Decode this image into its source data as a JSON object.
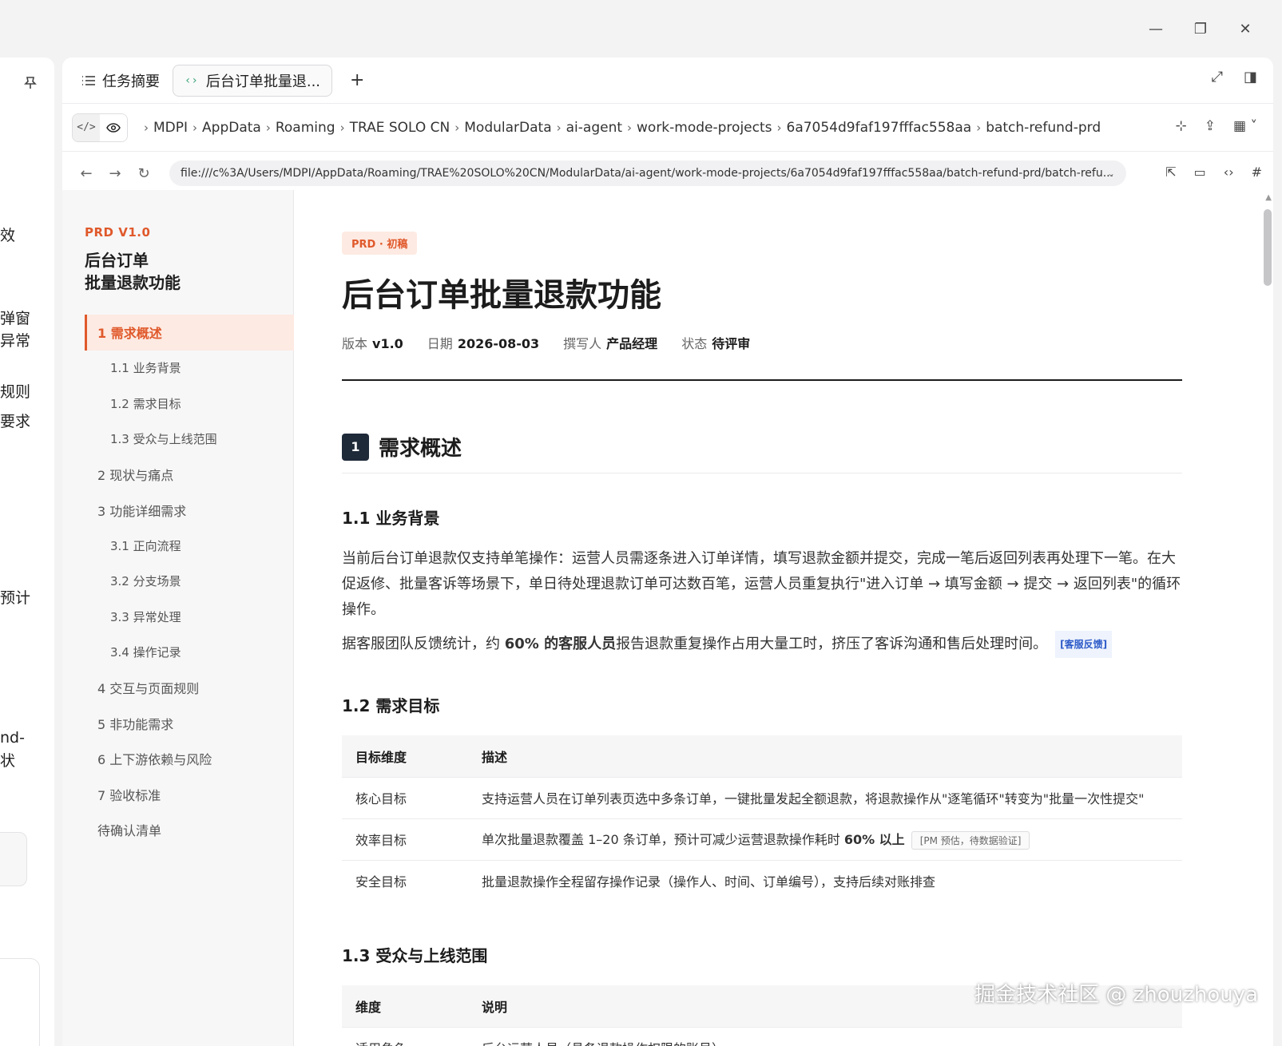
{
  "window": {
    "minimize": "—",
    "restore": "❐",
    "close": "✕"
  },
  "left_strip": {
    "texts": [
      "效",
      "弹窗",
      "异常",
      "规则",
      "要求",
      "预计",
      "nd-",
      "状"
    ]
  },
  "tabs": {
    "summary_label": "任务摘要",
    "active_label": "后台订单批量退...",
    "add_label": "+"
  },
  "breadcrumbs": [
    "MDPI",
    "AppData",
    "Roaming",
    "TRAE SOLO CN",
    "ModularData",
    "ai-agent",
    "work-mode-projects",
    "6a7054d9faf197fffac558aa",
    "batch-refund-prd",
    "batch-refund-prd."
  ],
  "url": {
    "value": "file:///c%3A/Users/MDPI/AppData/Roaming/TRAE%20SOLO%20CN/ModularData/ai-agent/work-mode-projects/6a7054d9faf197fffac558aa/batch-refund-prd/batch-refu..."
  },
  "toc": {
    "tag": "PRD V1.0",
    "title_line1": "后台订单",
    "title_line2": "批量退款功能",
    "items": [
      {
        "label": "1 需求概述",
        "level": 1,
        "active": true
      },
      {
        "label": "1.1 业务背景",
        "level": 2
      },
      {
        "label": "1.2 需求目标",
        "level": 2
      },
      {
        "label": "1.3 受众与上线范围",
        "level": 2
      },
      {
        "label": "2 现状与痛点",
        "level": 1
      },
      {
        "label": "3 功能详细需求",
        "level": 1
      },
      {
        "label": "3.1 正向流程",
        "level": 2
      },
      {
        "label": "3.2 分支场景",
        "level": 2
      },
      {
        "label": "3.3 异常处理",
        "level": 2
      },
      {
        "label": "3.4 操作记录",
        "level": 2
      },
      {
        "label": "4 交互与页面规则",
        "level": 1
      },
      {
        "label": "5 非功能需求",
        "level": 1
      },
      {
        "label": "6 上下游依赖与风险",
        "level": 1
      },
      {
        "label": "7 验收标准",
        "level": 1
      },
      {
        "label": "待确认清单",
        "level": 1
      }
    ]
  },
  "doc": {
    "badge": "PRD · 初稿",
    "title": "后台订单批量退款功能",
    "meta": {
      "version_label": "版本",
      "version": "v1.0",
      "date_label": "日期",
      "date": "2026-08-03",
      "author_label": "撰写人",
      "author": "产品经理",
      "status_label": "状态",
      "status": "待评审"
    },
    "section1": {
      "num": "1",
      "title": "需求概述"
    },
    "s11": {
      "title": "1.1 业务背景",
      "para1": "当前后台订单退款仅支持单笔操作：运营人员需逐条进入订单详情，填写退款金额并提交，完成一笔后返回列表再处理下一笔。在大促返修、批量客诉等场景下，单日待处理退款订单可达数百笔，运营人员重复执行\"进入订单 → 填写金额 → 提交 → 返回列表\"的循环操作。",
      "para2_pre": "据客服团队反馈统计，约 ",
      "para2_bold": "60% 的客服人员",
      "para2_post": "报告退款重复操作占用大量工时，挤压了客诉沟通和售后处理时间。",
      "cite": "[客服反馈]"
    },
    "s12": {
      "title": "1.2 需求目标",
      "headers": [
        "目标维度",
        "描述"
      ],
      "rows": [
        {
          "dim": "核心目标",
          "desc": "支持运营人员在订单列表页选中多条订单，一键批量发起全额退款，将退款操作从\"逐笔循环\"转变为\"批量一次性提交\""
        },
        {
          "dim": "效率目标",
          "desc_pre": "单次批量退款覆盖 1–20 条订单，预计可减少运营退款操作耗时 ",
          "desc_bold": "60% 以上",
          "note": "[PM 预估，待数据验证]"
        },
        {
          "dim": "安全目标",
          "desc": "批量退款操作全程留存操作记录（操作人、时间、订单编号），支持后续对账排查"
        }
      ]
    },
    "s13": {
      "title": "1.3 受众与上线范围",
      "headers": [
        "维度",
        "说明"
      ],
      "rows": [
        {
          "dim": "适用角色",
          "desc": "后台运营人员（具备退款操作权限的账号）"
        }
      ]
    }
  },
  "watermark": "掘金技术社区 @ zhouzhouya"
}
